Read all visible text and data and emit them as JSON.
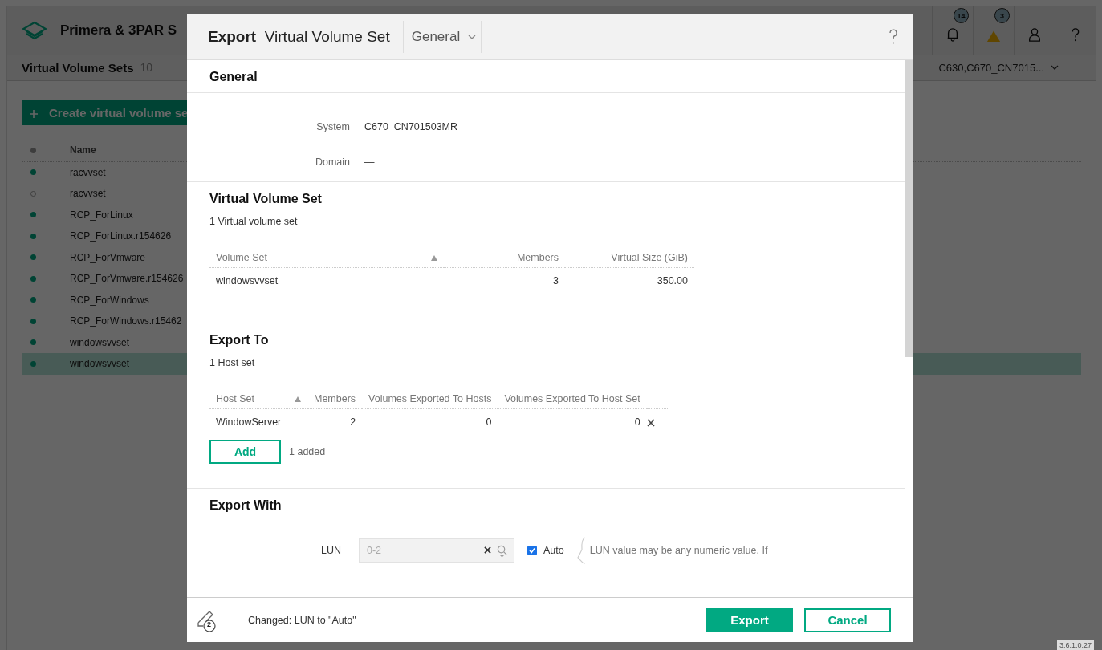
{
  "app": {
    "title": "Primera & 3PAR S",
    "alerts": [
      {
        "kind": "bell",
        "count": "14"
      },
      {
        "kind": "warning",
        "count": "3"
      }
    ],
    "page_title": "Virtual Volume Sets",
    "page_count": "10",
    "system_selector": "C630,C670_CN7015...",
    "create_button": "Create virtual volume se",
    "list_header": "Name",
    "rows": [
      {
        "name": "racvvset",
        "filled": true,
        "selected": false
      },
      {
        "name": "racvvset",
        "filled": false,
        "selected": false
      },
      {
        "name": "RCP_ForLinux",
        "filled": true,
        "selected": false
      },
      {
        "name": "RCP_ForLinux.r154626",
        "filled": true,
        "selected": false
      },
      {
        "name": "RCP_ForVmware",
        "filled": true,
        "selected": false
      },
      {
        "name": "RCP_ForVmware.r154626",
        "filled": true,
        "selected": false
      },
      {
        "name": "RCP_ForWindows",
        "filled": true,
        "selected": false
      },
      {
        "name": "RCP_ForWindows.r15462",
        "filled": true,
        "selected": false
      },
      {
        "name": "windowsvvset",
        "filled": true,
        "selected": false
      },
      {
        "name": "windowsvvset",
        "filled": true,
        "selected": true
      }
    ],
    "version": "3.6.1.0.27"
  },
  "dialog": {
    "title_bold": "Export",
    "title": "Virtual Volume Set",
    "section_menu": "General",
    "general": {
      "heading": "General",
      "fields": [
        {
          "label": "System",
          "value": "C670_CN701503MR"
        },
        {
          "label": "Domain",
          "value": "—"
        }
      ]
    },
    "volume_set": {
      "heading": "Virtual Volume Set",
      "summary": "1 Virtual volume set",
      "columns": [
        {
          "label": "Volume Set",
          "sorted": true
        },
        {
          "label": "Members"
        },
        {
          "label": "Virtual Size (GiB)"
        }
      ],
      "rows": [
        [
          "windowsvvset",
          "3",
          "350.00"
        ]
      ]
    },
    "export_to": {
      "heading": "Export To",
      "summary": "1 Host set",
      "columns": [
        {
          "label": "Host Set",
          "sorted": true
        },
        {
          "label": "Members"
        },
        {
          "label": "Volumes Exported To Hosts"
        },
        {
          "label": "Volumes Exported To Host Set"
        }
      ],
      "rows": [
        [
          "WindowServer",
          "2",
          "0",
          "0"
        ]
      ],
      "add_button": "Add",
      "added_note": "1 added"
    },
    "export_with": {
      "heading": "Export With",
      "lun": {
        "label": "LUN",
        "placeholder": "0-2",
        "disabled": true
      },
      "auto": {
        "label": "Auto",
        "checked": true
      },
      "hint": "LUN value may be any numeric value. If"
    },
    "footer": {
      "changes_count": "2",
      "message": "Changed: LUN to \"Auto\"",
      "buttons": [
        {
          "label": "Export",
          "kind": "primary"
        },
        {
          "label": "Cancel",
          "kind": "secondary"
        }
      ]
    }
  }
}
